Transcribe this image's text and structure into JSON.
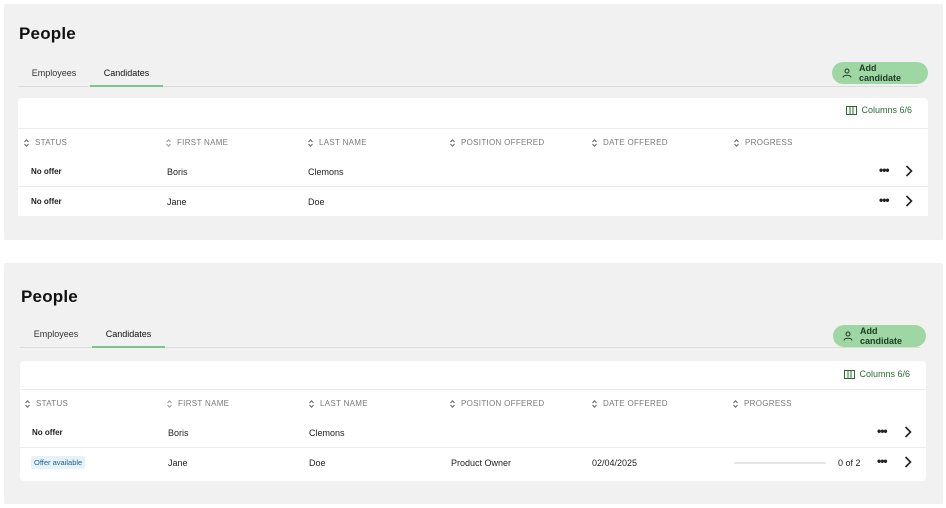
{
  "panels": [
    {
      "title": "People",
      "tabs": [
        {
          "label": "Employees"
        },
        {
          "label": "Candidates"
        }
      ],
      "add_button": "Add candidate",
      "columns_button": "Columns 6/6",
      "headers": [
        "STATUS",
        "FIRST NAME",
        "LAST NAME",
        "POSITION OFFERED",
        "DATE OFFERED",
        "PROGRESS"
      ],
      "rows": [
        {
          "status": "No offer",
          "first": "Boris",
          "last": "Clemons",
          "position": "",
          "date": "",
          "progress": ""
        },
        {
          "status": "No offer",
          "first": "Jane",
          "last": "Doe",
          "position": "",
          "date": "",
          "progress": ""
        }
      ]
    },
    {
      "title": "People",
      "tabs": [
        {
          "label": "Employees"
        },
        {
          "label": "Candidates"
        }
      ],
      "add_button": "Add candidate",
      "columns_button": "Columns 6/6",
      "headers": [
        "STATUS",
        "FIRST NAME",
        "LAST NAME",
        "POSITION OFFERED",
        "DATE OFFERED",
        "PROGRESS"
      ],
      "rows": [
        {
          "status": "No offer",
          "first": "Boris",
          "last": "Clemons",
          "position": "",
          "date": "",
          "progress": ""
        },
        {
          "status": "Offer available",
          "first": "Jane",
          "last": "Doe",
          "position": "Product Owner",
          "date": "02/04/2025",
          "progress": "0 of 2"
        }
      ]
    }
  ],
  "icons": {
    "sort": "sort-icon",
    "user": "user-icon",
    "columns": "columns-icon",
    "more": "more-icon",
    "chevron": "chevron-right-icon"
  },
  "colors": {
    "accent": "#9fd7a4",
    "tab_underline": "#7cc48b",
    "badge_bg": "#e6f2fa",
    "badge_text": "#1f5f86"
  }
}
